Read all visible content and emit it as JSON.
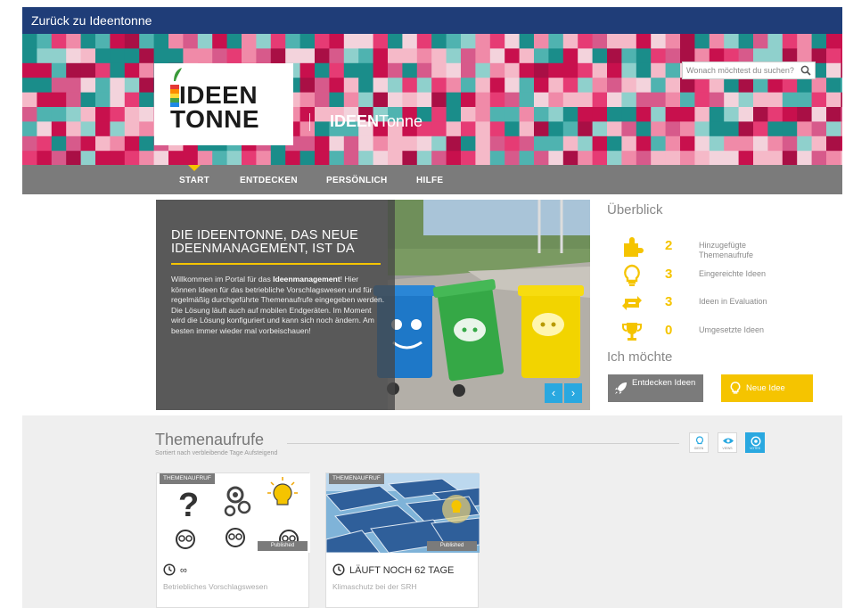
{
  "topbar": {
    "back_label": "Zurück zu Ideentonne"
  },
  "banner": {
    "logo_line1": "IDEEN",
    "logo_line2": "TONNE",
    "brand_bold": "IDEEN",
    "brand_rest": "Tonne",
    "search_placeholder": "Wonach möchtest du suchen?"
  },
  "nav": {
    "items": [
      {
        "label": "START",
        "active": true
      },
      {
        "label": "ENTDECKEN"
      },
      {
        "label": "PERSÖNLICH"
      },
      {
        "label": "HILFE"
      }
    ]
  },
  "hero": {
    "title": "DIE IDEENTONNE, DAS NEUE IDEENMANAGEMENT, IST DA",
    "intro": "Willkommen im Portal für das",
    "intro_bold": "Ideenmanagement",
    "intro_rest": "! Hier können Ideen für das betriebliche Vorschlagswesen und für regelmäßig durchgeführte Themenaufrufe eingegeben werden. Die Lösung läuft auch auf mobilen Endgeräten. Im Moment wird die Lösung konfiguriert und kann sich noch ändern. Am besten immer wieder mal vorbeischauen!",
    "prev": "‹",
    "next": "›"
  },
  "overview": {
    "title": "Überblick",
    "rows": [
      {
        "icon": "puzzle-icon",
        "count": "2",
        "label": "Hinzugefügte Themenaufrufe"
      },
      {
        "icon": "lightbulb-icon",
        "count": "3",
        "label": "Eingereichte Ideen"
      },
      {
        "icon": "cycle-arrows-icon",
        "count": "3",
        "label": "Ideen in Evaluation"
      },
      {
        "icon": "trophy-icon",
        "count": "0",
        "label": "Umgesetzte Ideen"
      }
    ]
  },
  "actions": {
    "title": "Ich möchte",
    "explore": "Entdecken Ideen",
    "new_idea": "Neue Idee"
  },
  "themen": {
    "title": "Themenaufrufe",
    "subtitle": "Sortiert nach verbleibende Tage Aufsteigend",
    "views": [
      "IDEEN",
      "VIEWS",
      "VOTES"
    ],
    "cards": [
      {
        "badge": "THEMENAUFRUF",
        "status": "Published",
        "time": "∞",
        "desc": "Betriebliches Vorschlagswesen"
      },
      {
        "badge": "THEMENAUFRUF",
        "status": "Published",
        "time": "LÄUFT NOCH 62 TAGE",
        "desc": "Klimaschutz bei der SRH"
      }
    ]
  },
  "colors": {
    "topbar": "#1f3d78",
    "accent_yellow": "#f5c400",
    "accent_blue": "#29a8e0",
    "nav_gray": "#7b7b7b"
  }
}
